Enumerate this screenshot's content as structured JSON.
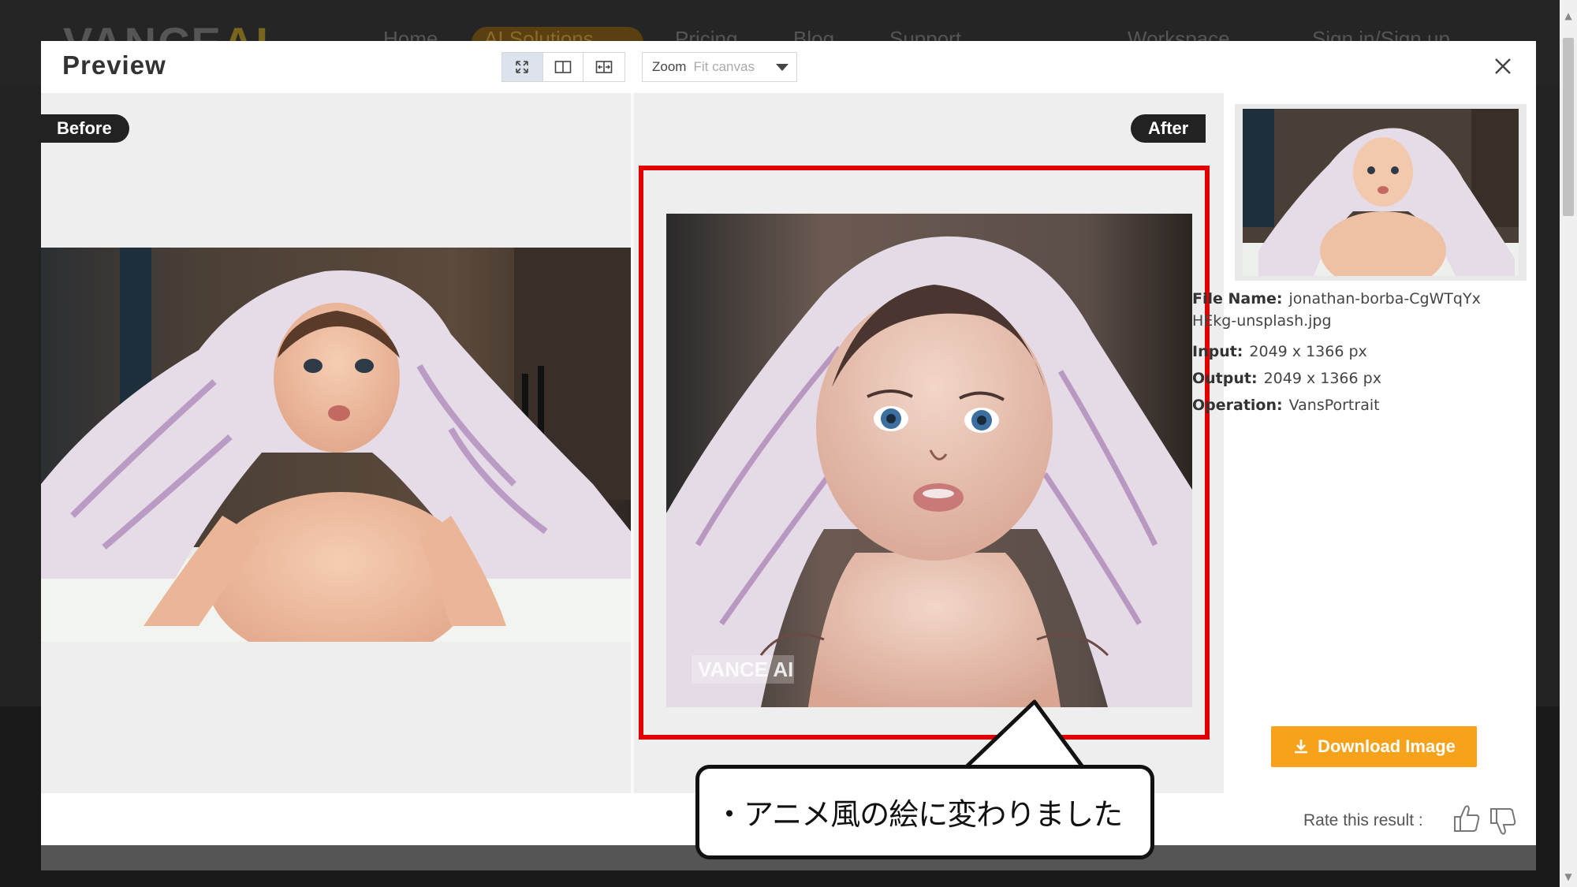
{
  "background": {
    "logo_main": "VANCE",
    "logo_accent": "AI",
    "nav": [
      "Home",
      "AI Solutions",
      "Pricing",
      "Blog",
      "Support",
      "Workspace",
      "Sign in/Sign up"
    ]
  },
  "modal": {
    "title": "Preview",
    "view_modes": [
      "fit-icon",
      "split-icon",
      "compare-icon"
    ],
    "zoom_label": "Zoom",
    "zoom_value": "Fit canvas"
  },
  "compare": {
    "before_label": "Before",
    "after_label": "After",
    "watermark": "VANCE AI"
  },
  "info": {
    "file_name_label": "File Name:",
    "file_name_line1": "jonathan-borba-CgWTqYx",
    "file_name_line2": "HEkg-unsplash.jpg",
    "input_label": "Input:",
    "input_value": "2049 x 1366 px",
    "output_label": "Output:",
    "output_value": "2049 x 1366 px",
    "operation_label": "Operation:",
    "operation_value": "VansPortrait"
  },
  "download": {
    "label": "Download Image"
  },
  "rating": {
    "label": "Rate this result :"
  },
  "callout": {
    "text": "・アニメ風の絵に変わりました"
  },
  "colors": {
    "accent": "#f7a21b",
    "highlight": "#e00000",
    "pill": "#222222"
  }
}
